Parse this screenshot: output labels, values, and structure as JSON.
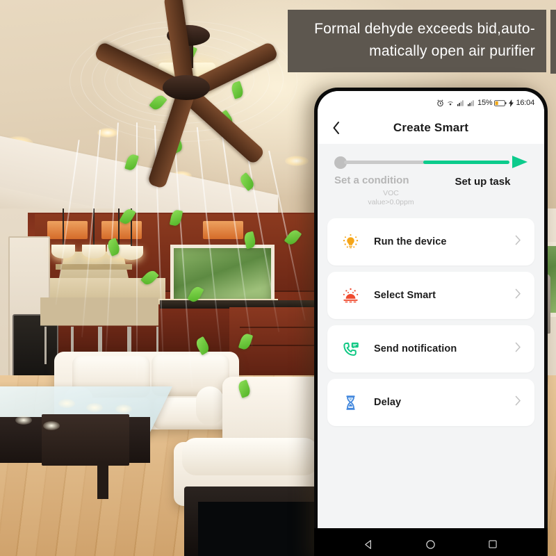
{
  "caption": {
    "line1": "Formal dehyde exceeds bid,auto-",
    "line2": "matically open air purifier"
  },
  "colors": {
    "accent_green": "#0ccb8c",
    "banner_bg": "#5d574f",
    "screen_bg": "#f3f4f5",
    "card_bg": "#ffffff",
    "icon_bulb": "#f5a518",
    "icon_sunrise": "#ef4a2e",
    "icon_phone": "#10c884",
    "icon_hourglass": "#4287dd"
  },
  "phone": {
    "statusbar": {
      "alarm_icon": "alarm-icon",
      "wifi_icon": "wifi-icon",
      "signal1_icon": "signal-bars-icon",
      "signal2_icon": "signal-bars-icon",
      "battery_percent": "15%",
      "battery_icon": "battery-icon",
      "charging_icon": "charging-bolt-icon",
      "time": "16:04"
    },
    "appbar": {
      "back_icon": "back-chevron-icon",
      "title": "Create Smart"
    },
    "stepper": {
      "step1": {
        "label": "Set a condition",
        "sub_line1": "VOC",
        "sub_line2": "value>0.0ppm",
        "state": "completed"
      },
      "step2": {
        "label": "Set up task",
        "state": "active"
      }
    },
    "cards": [
      {
        "icon": "lightbulb-icon",
        "label": "Run the device",
        "chevron": "chevron-right-icon"
      },
      {
        "icon": "sunrise-icon",
        "label": "Select Smart",
        "chevron": "chevron-right-icon"
      },
      {
        "icon": "phone-message-icon",
        "label": "Send notification",
        "chevron": "chevron-right-icon"
      },
      {
        "icon": "hourglass-icon",
        "label": "Delay",
        "chevron": "chevron-right-icon"
      }
    ],
    "navbar": {
      "back_icon": "nav-back-triangle-icon",
      "home_icon": "nav-home-circle-icon",
      "recents_icon": "nav-recents-square-icon"
    }
  },
  "scene": {
    "description": "living-room-with-ceiling-fan",
    "fan": "ceiling-fan",
    "airflow": "airflow-swirl",
    "leaves": "green-leaf-particle"
  }
}
